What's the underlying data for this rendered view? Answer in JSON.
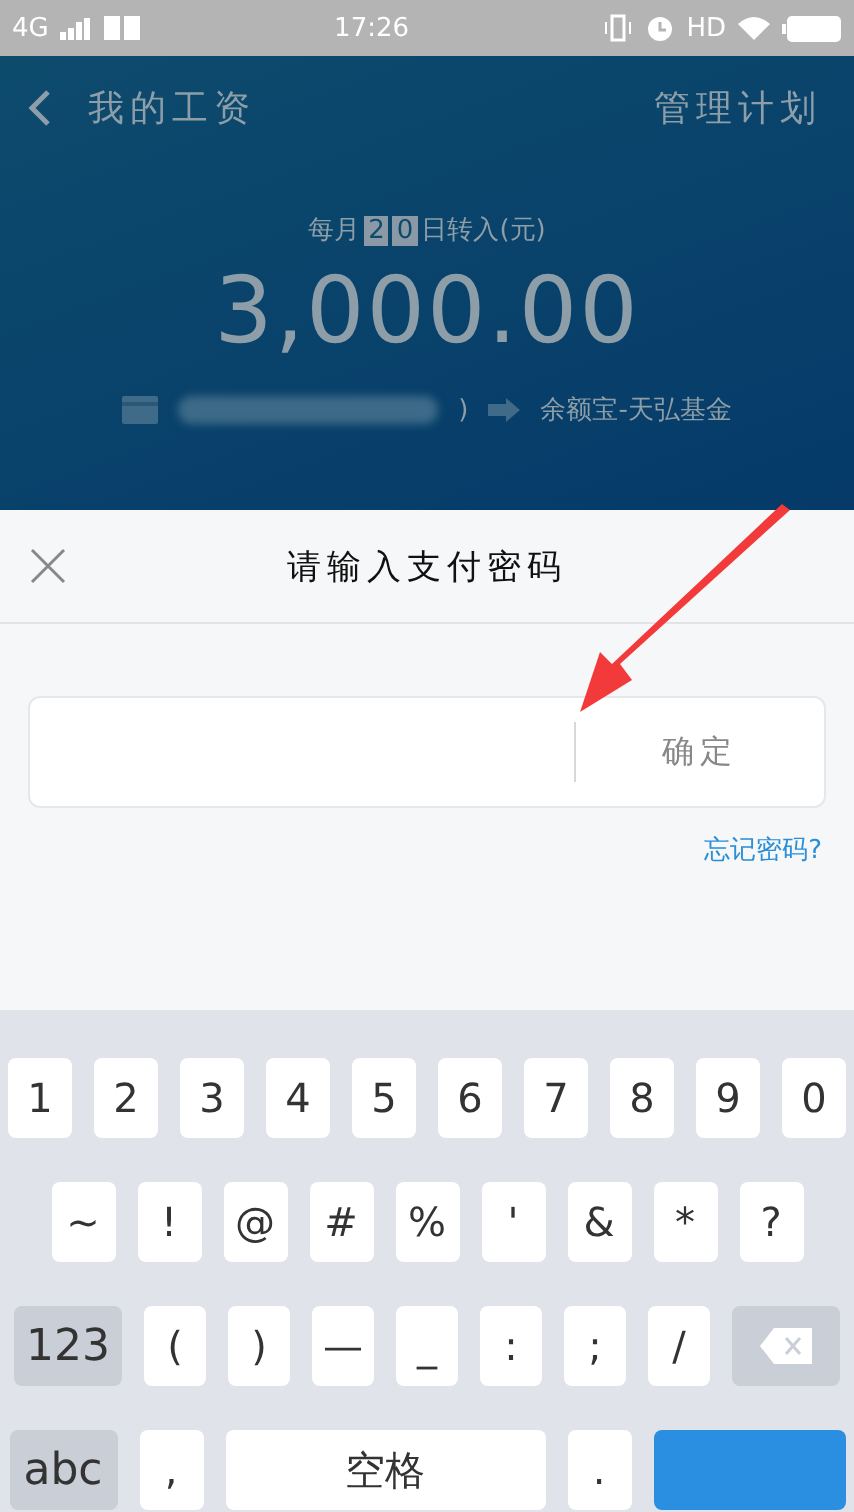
{
  "status_bar": {
    "network": "4G",
    "time": "17:26",
    "hd": "HD"
  },
  "header": {
    "title": "我的工资",
    "action": "管理计划"
  },
  "plan": {
    "caption_prefix": "每月",
    "day_digits": [
      "2",
      "0"
    ],
    "caption_suffix": "日转入(元)",
    "amount": "3,000.00",
    "card_suffix": ")",
    "target": "余额宝-天弘基金"
  },
  "dialog": {
    "title": "请输入支付密码",
    "confirm": "确定",
    "forgot": "忘记密码?"
  },
  "keyboard": {
    "rows": [
      [
        {
          "kind": "char",
          "label": "1"
        },
        {
          "kind": "char",
          "label": "2"
        },
        {
          "kind": "char",
          "label": "3"
        },
        {
          "kind": "char",
          "label": "4"
        },
        {
          "kind": "char",
          "label": "5"
        },
        {
          "kind": "char",
          "label": "6"
        },
        {
          "kind": "char",
          "label": "7"
        },
        {
          "kind": "char",
          "label": "8"
        },
        {
          "kind": "char",
          "label": "9"
        },
        {
          "kind": "char",
          "label": "0"
        }
      ],
      [
        {
          "kind": "char",
          "label": "~"
        },
        {
          "kind": "char",
          "label": "!"
        },
        {
          "kind": "char",
          "label": "@"
        },
        {
          "kind": "char",
          "label": "#"
        },
        {
          "kind": "char",
          "label": "%"
        },
        {
          "kind": "char",
          "label": "'"
        },
        {
          "kind": "char",
          "label": "&"
        },
        {
          "kind": "char",
          "label": "*"
        },
        {
          "kind": "char",
          "label": "?"
        }
      ],
      [
        {
          "kind": "function",
          "label": "123"
        },
        {
          "kind": "char",
          "label": "("
        },
        {
          "kind": "char",
          "label": ")"
        },
        {
          "kind": "char",
          "label": "—"
        },
        {
          "kind": "char",
          "label": "_"
        },
        {
          "kind": "char",
          "label": ":"
        },
        {
          "kind": "char",
          "label": ";"
        },
        {
          "kind": "char",
          "label": "/"
        },
        {
          "kind": "backspace"
        }
      ],
      [
        {
          "kind": "function",
          "label": "abc"
        },
        {
          "kind": "char",
          "label": ","
        },
        {
          "kind": "space",
          "label": "空格"
        },
        {
          "kind": "char",
          "label": "."
        },
        {
          "kind": "action"
        }
      ]
    ]
  }
}
